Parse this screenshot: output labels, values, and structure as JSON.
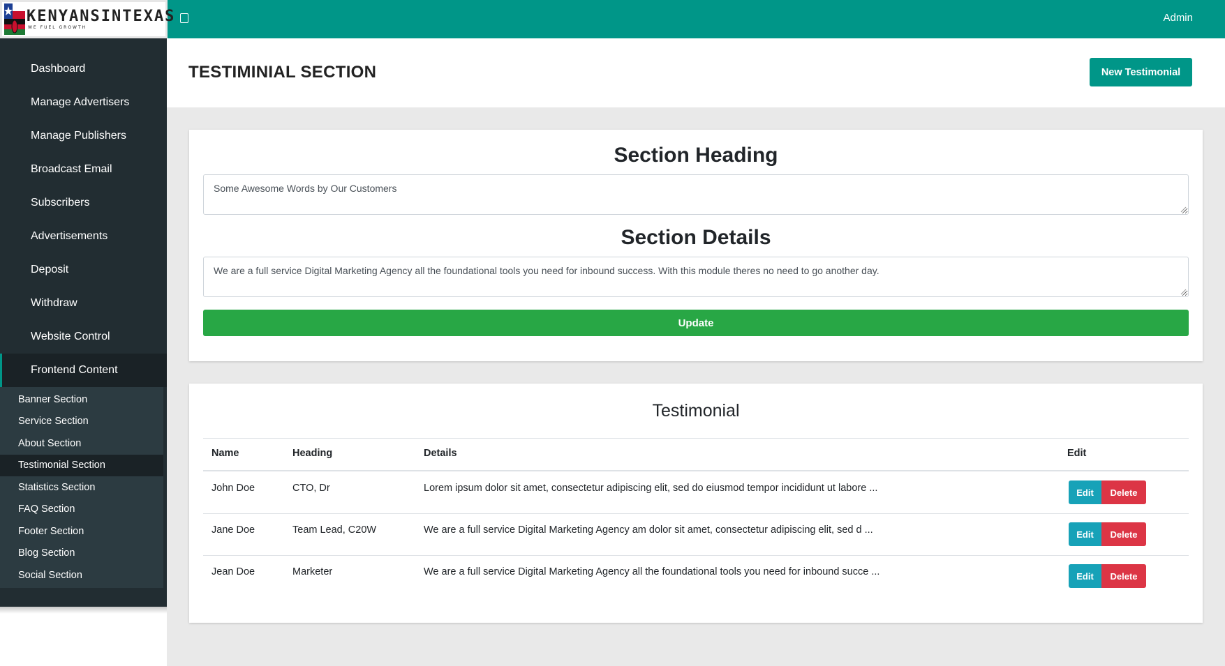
{
  "brand": {
    "name": "KENYANSINTEXAS",
    "tagline": "WE FUEL GROWTH",
    "colors": {
      "topbar": "#009688",
      "sidebar": "#222d32",
      "submenu": "#2c3b41",
      "update": "#28a745",
      "edit": "#17a2b8",
      "delete": "#dc3545"
    }
  },
  "topbar": {
    "menu_icon": "menu-toggle-icon",
    "user_label": "Admin"
  },
  "sidebar": {
    "items": [
      {
        "label": "Dashboard"
      },
      {
        "label": "Manage Advertisers"
      },
      {
        "label": "Manage Publishers"
      },
      {
        "label": "Broadcast Email"
      },
      {
        "label": "Subscribers"
      },
      {
        "label": "Advertisements"
      },
      {
        "label": "Deposit"
      },
      {
        "label": "Withdraw"
      },
      {
        "label": "Website Control"
      },
      {
        "label": "Frontend Content"
      }
    ],
    "submenu": [
      {
        "label": "Banner Section"
      },
      {
        "label": "Service Section"
      },
      {
        "label": "About Section"
      },
      {
        "label": "Testimonial Section"
      },
      {
        "label": "Statistics Section"
      },
      {
        "label": "FAQ Section"
      },
      {
        "label": "Footer Section"
      },
      {
        "label": "Blog Section"
      },
      {
        "label": "Social Section"
      }
    ]
  },
  "header": {
    "title": "TESTIMINIAL SECTION",
    "new_button": "New Testimonial"
  },
  "section_form": {
    "heading_label": "Section Heading",
    "heading_value": "Some Awesome Words by Our Customers",
    "details_label": "Section Details",
    "details_value": "We are a full service Digital Marketing Agency all the foundational tools you need for inbound success. With this module theres no need to go another day.",
    "update_button": "Update"
  },
  "testimonial_table": {
    "title": "Testimonial",
    "columns": {
      "name": "Name",
      "heading": "Heading",
      "details": "Details",
      "edit": "Edit"
    },
    "rows": [
      {
        "name": "John Doe",
        "heading": "CTO, Dr",
        "details": "Lorem ipsum dolor sit amet, consectetur adipiscing elit, sed do eiusmod tempor incididunt ut labore ...",
        "edit_label": "Edit",
        "delete_label": "Delete"
      },
      {
        "name": "Jane Doe",
        "heading": "Team Lead, C20W",
        "details": "We are a full service Digital Marketing Agency am dolor sit amet, consectetur adipiscing elit, sed d ...",
        "edit_label": "Edit",
        "delete_label": "Delete"
      },
      {
        "name": "Jean Doe",
        "heading": "Marketer",
        "details": "We are a full service Digital Marketing Agency all the foundational tools you need for inbound succe ...",
        "edit_label": "Edit",
        "delete_label": "Delete"
      }
    ]
  }
}
